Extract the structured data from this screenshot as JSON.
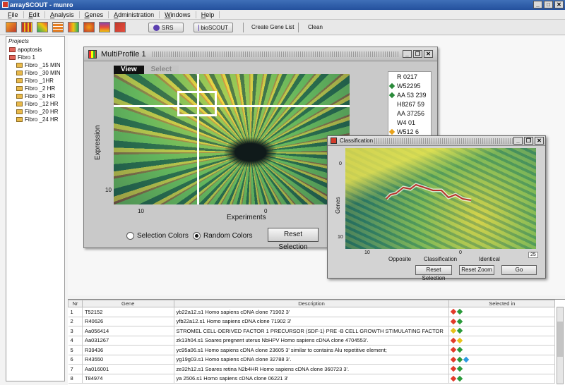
{
  "app": {
    "title": "arraySCOUT - munro"
  },
  "menu": [
    "File",
    "Edit",
    "Analysis",
    "Genes",
    "Administration",
    "Windows",
    "Help"
  ],
  "toolbar": {
    "srs_label": "SRS",
    "bioscout_label": "bioSCOUT",
    "create_gene_list": "Create Gene List",
    "clean": "Clean"
  },
  "projects": {
    "header": "Projects",
    "items": [
      {
        "label": "apoptosis",
        "level": 0,
        "color": "red"
      },
      {
        "label": "Fibro 1",
        "level": 0,
        "color": "red"
      },
      {
        "label": "Fibro _15 MIN",
        "level": 1,
        "color": "yellow"
      },
      {
        "label": "Fibro _30 MIN",
        "level": 1,
        "color": "yellow"
      },
      {
        "label": "Fibro _1HR",
        "level": 1,
        "color": "yellow"
      },
      {
        "label": "Fibro _2 HR",
        "level": 1,
        "color": "yellow"
      },
      {
        "label": "Fibro _8 HR",
        "level": 1,
        "color": "yellow"
      },
      {
        "label": "Fibro _12 HR",
        "level": 1,
        "color": "yellow"
      },
      {
        "label": "Fibro _20 HR",
        "level": 1,
        "color": "yellow"
      },
      {
        "label": "Fibro _24 HR",
        "level": 1,
        "color": "yellow"
      }
    ]
  },
  "multiprofile": {
    "title": "MultiProfile 1",
    "tabs": [
      "View",
      "Select"
    ],
    "ylabel": "Expression",
    "xlabel": "Experiments",
    "xticks": [
      "10",
      "0"
    ],
    "yticks": [
      "10"
    ],
    "selection_colors": "Selection Colors",
    "random_colors": "Random Colors",
    "reset_selection": "Reset Selection",
    "genes": [
      {
        "label": "R 0217",
        "color": ""
      },
      {
        "label": "W52295",
        "color": "#2a8a3a"
      },
      {
        "label": "AA 53 239",
        "color": "#2a8a3a"
      },
      {
        "label": "H8267 59",
        "color": ""
      },
      {
        "label": "AA 37256",
        "color": ""
      },
      {
        "label": "W4 01",
        "color": ""
      },
      {
        "label": "W512 6",
        "color": "#e8a21a"
      }
    ]
  },
  "classification": {
    "title": "Classification",
    "ylabel": "Genes",
    "yticks": [
      "0",
      "10"
    ],
    "xticks": [
      "10",
      "0"
    ],
    "legend_opposite": "Opposite",
    "legend_classification": "Classification",
    "legend_identical": "Identical",
    "zoom_value": "25",
    "reset_selection": "Reset Selection",
    "reset_zoom": "Reset Zoom",
    "go": "Go"
  },
  "table": {
    "headers": [
      "Nr",
      "Gene",
      "Description",
      "Selected in"
    ],
    "rows": [
      {
        "nr": "1",
        "gene": "T52152",
        "desc": "yb22a12.s1 Homo sapiens cDNA clone 71902 3'",
        "sel": [
          "#e23b2a",
          "#2a9a3a"
        ]
      },
      {
        "nr": "2",
        "gene": "R40626",
        "desc": "yfb22a12.s1 Homo sapiens cDNA clone 71902 3'",
        "sel": [
          "#e23b2a",
          "#2a9a3a"
        ]
      },
      {
        "nr": "3",
        "gene": "Aa056414",
        "desc": "STROMEL CELL-DERIVED FACTOR 1 PRECURSOR (SDF-1) PRE -B CELL GROWTH STIMULATING FACTOR",
        "sel": [
          "#e8c21a",
          "#2a9a3a"
        ]
      },
      {
        "nr": "4",
        "gene": "Aa031267",
        "desc": "zk13h04.s1 Soares pregnent uterus NbHPV Homo sapiens cDNA clone 4704553'.",
        "sel": [
          "#e23b2a",
          "#e8c21a"
        ]
      },
      {
        "nr": "5",
        "gene": "R39436",
        "desc": "yc95a06.s1 Homo sapiens cDNA clone 23605 3' similar to contains Alu repetitive element;",
        "sel": [
          "#e23b2a",
          "#2a9a3a"
        ]
      },
      {
        "nr": "6",
        "gene": "R43550",
        "desc": "yg19g03.s1 Homo sapiens cDNA clone 32788 3'.",
        "sel": [
          "#e23b2a",
          "#2a9a3a",
          "#2a9ae0"
        ]
      },
      {
        "nr": "7",
        "gene": "Aa016001",
        "desc": "ze32h12.s1 Soares retina N2b4HR Homo sapiens cDNA clone 360723 3'.",
        "sel": [
          "#e23b2a",
          "#2a9a3a"
        ]
      },
      {
        "nr": "8",
        "gene": "T84974",
        "desc": "ya 2506.s1 Homo sapiens cDNA clone 06221 3'",
        "sel": [
          "#e23b2a",
          "#2a9a3a"
        ]
      }
    ]
  }
}
